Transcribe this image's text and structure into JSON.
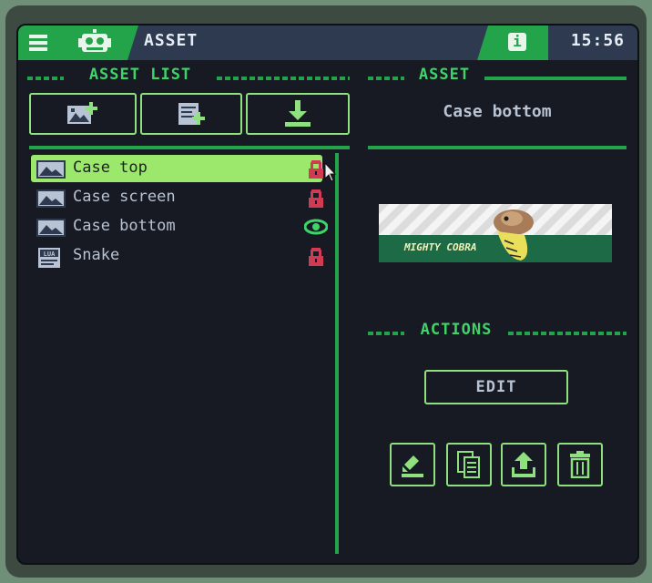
{
  "header": {
    "title": "ASSET",
    "time": "15:56",
    "icons": {
      "menu": "hamburger-menu-icon",
      "robot": "robot-icon",
      "info": "info-icon"
    },
    "info_glyph": "i"
  },
  "left_panel": {
    "section_title": "ASSET LIST",
    "toolbar": [
      {
        "name": "add-image-asset",
        "icon": "image-plus-icon"
      },
      {
        "name": "add-code-asset",
        "icon": "code-plus-icon"
      },
      {
        "name": "import-asset",
        "icon": "download-icon"
      }
    ],
    "items": [
      {
        "label": "Case top",
        "icon": "image-icon",
        "status": "lock-icon",
        "selected": true
      },
      {
        "label": "Case screen",
        "icon": "image-icon",
        "status": "lock-icon",
        "selected": false
      },
      {
        "label": "Case bottom",
        "icon": "image-icon",
        "status": "eye-icon",
        "selected": false
      },
      {
        "label": "Snake",
        "icon": "lua-file-icon",
        "status": "lock-icon",
        "selected": false
      }
    ],
    "lua_tag": "LUA"
  },
  "right_panel": {
    "section_title": "ASSET",
    "asset_name": "Case bottom",
    "preview_text": "MIGHTY COBRA",
    "actions_title": "ACTIONS",
    "edit_label": "EDIT",
    "action_icons": [
      "rename-icon",
      "duplicate-icon",
      "export-icon",
      "delete-icon"
    ]
  },
  "colors": {
    "accent": "#23a34a",
    "accent_light": "#8fe07f",
    "selection": "#9be86d",
    "lock": "#d03a52",
    "eye": "#3fd46a",
    "text": "#b8c3d3",
    "background": "#171a22"
  }
}
